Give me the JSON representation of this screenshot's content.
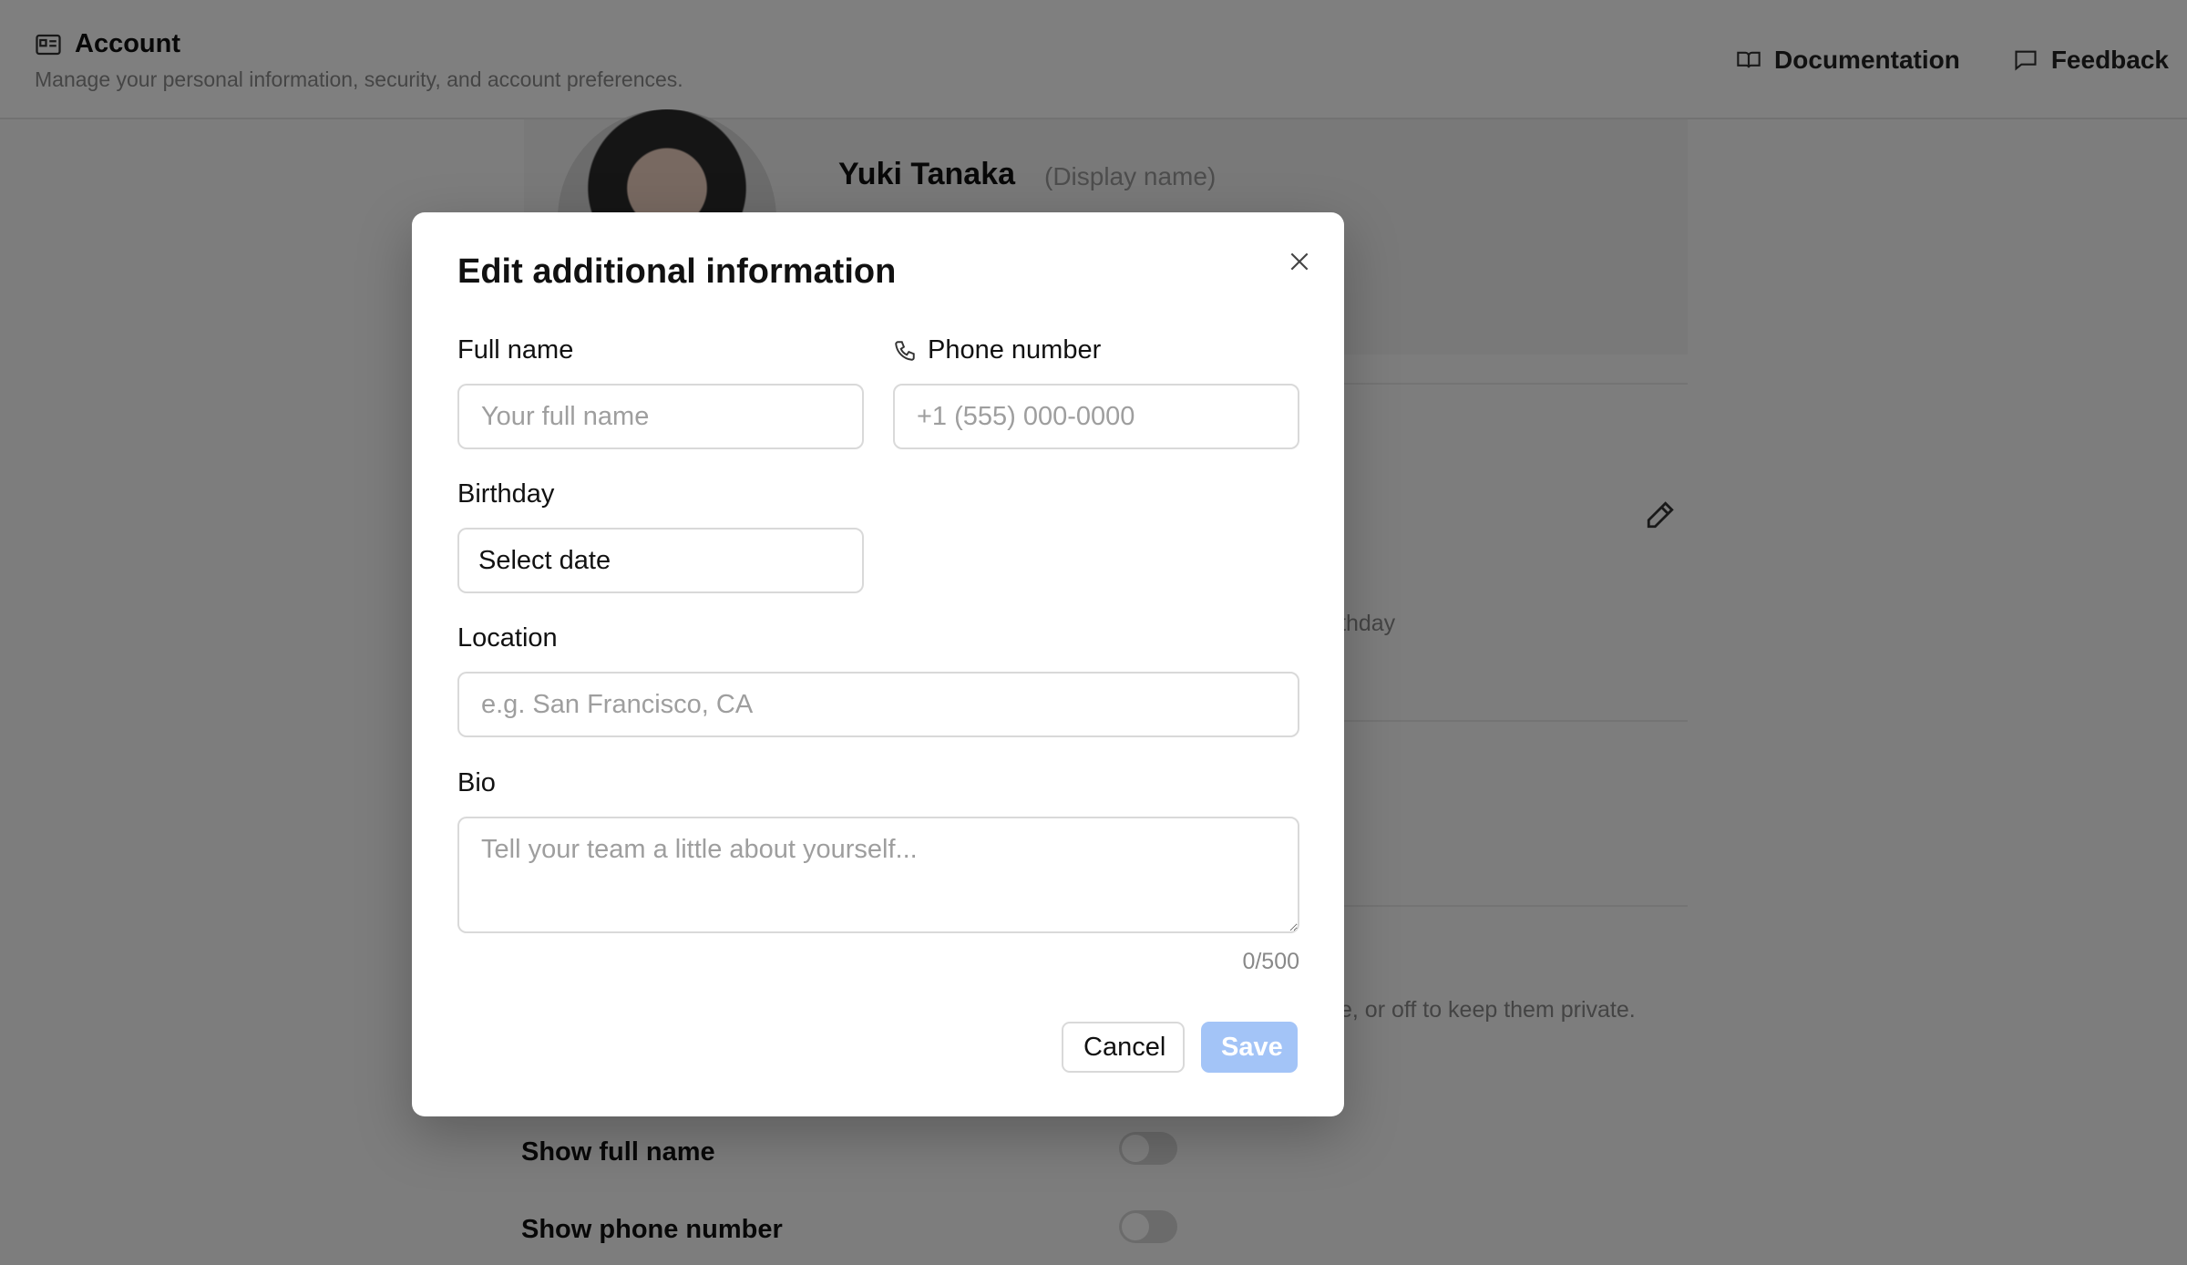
{
  "header": {
    "title": "Account",
    "subtitle": "Manage your personal information, security, and account preferences.",
    "links": [
      {
        "label": "Documentation",
        "icon": "book-icon"
      },
      {
        "label": "Feedback",
        "icon": "chat-icon"
      }
    ]
  },
  "profile": {
    "name": "Yuki Tanaka",
    "display_name_hint": "(Display name)"
  },
  "background_snippets": {
    "birthday_fragment": "thday",
    "privacy_fragment": "e, or off to keep them private."
  },
  "privacy_toggles": [
    {
      "label": "Show full name",
      "on": false
    },
    {
      "label": "Show phone number",
      "on": false
    }
  ],
  "modal": {
    "title": "Edit additional information",
    "full_name": {
      "label": "Full name",
      "placeholder": "Your full name",
      "value": ""
    },
    "phone": {
      "label": "Phone number",
      "placeholder": "+1 (555) 000-0000",
      "value": ""
    },
    "birthday": {
      "label": "Birthday",
      "value": "Select date"
    },
    "location": {
      "label": "Location",
      "placeholder": "e.g. San Francisco, CA",
      "value": ""
    },
    "bio": {
      "label": "Bio",
      "placeholder": "Tell your team a little about yourself...",
      "counter": "0/500"
    },
    "cancel_label": "Cancel",
    "save_label": "Save"
  },
  "colors": {
    "save_button": "#a3c4f7",
    "overlay": "rgba(0,0,0,0.5)"
  }
}
